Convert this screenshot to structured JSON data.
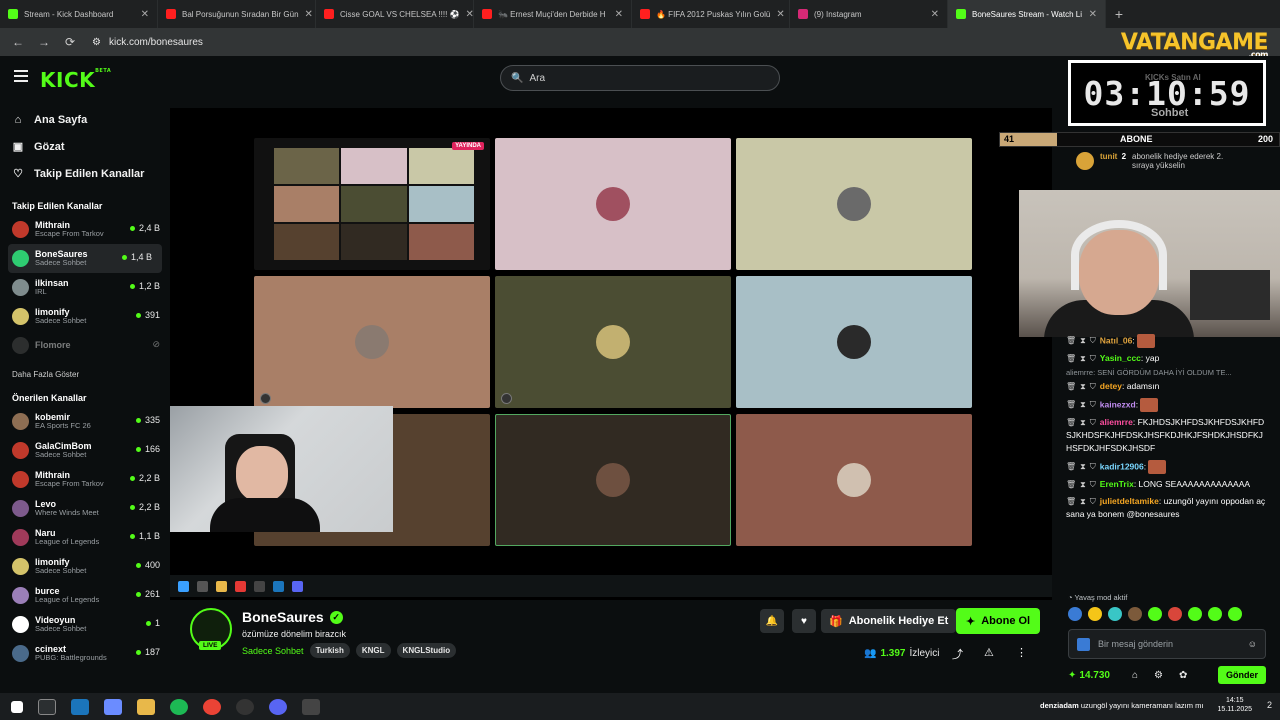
{
  "browser": {
    "tabs": [
      {
        "title": "Stream - Kick Dashboard",
        "color": "#53fc18"
      },
      {
        "title": "Bal Porsuğunun Sıradan Bir Gün",
        "color": "#ff1f1f"
      },
      {
        "title": "Cisse GOAL VS CHELSEA !!!! ⚽",
        "color": "#ff1f1f"
      },
      {
        "title": "🐜 Ernest Muçi'den Derbide H",
        "color": "#ff1f1f"
      },
      {
        "title": "🔥 FIFA 2012 Puskas Yılın Golü",
        "color": "#ff1f1f"
      },
      {
        "title": "(9) Instagram",
        "color": "#d62976"
      },
      {
        "title": "BoneSaures Stream - Watch Li",
        "color": "#53fc18",
        "active": true
      }
    ],
    "new_tab": "+",
    "url": "kick.com/bonesaures"
  },
  "overlay_logo": {
    "brand": "VATANGAME",
    "sub": ".com"
  },
  "header": {
    "logo": "KICK",
    "logo_sup": "BETA",
    "search_placeholder": "Ara"
  },
  "sidebar": {
    "nav": [
      {
        "label": "Ana Sayfa",
        "icon": "home-icon"
      },
      {
        "label": "Gözat",
        "icon": "browse-icon"
      },
      {
        "label": "Takip Edilen Kanallar",
        "icon": "heart-icon"
      }
    ],
    "followed_title": "Takip Edilen Kanallar",
    "followed": [
      {
        "name": "Mithrain",
        "category": "Escape From Tarkov",
        "viewers": "2,4 B",
        "color": "#c0392b"
      },
      {
        "name": "BoneSaures",
        "category": "Sadece Sohbet",
        "viewers": "1,4 B",
        "color": "#2ecc71",
        "selected": true
      },
      {
        "name": "ilkinsan",
        "category": "IRL",
        "viewers": "1,2 B",
        "color": "#7f8c8d"
      },
      {
        "name": "limonify",
        "category": "Sadece Sohbet",
        "viewers": "391",
        "color": "#d4c36a"
      },
      {
        "name": "Flomore",
        "category": "",
        "viewers": "",
        "color": "#555",
        "offline": true
      }
    ],
    "show_more": "Daha Fazla Göster",
    "recommended_title": "Önerilen Kanallar",
    "recommended": [
      {
        "name": "kobemir",
        "category": "EA Sports FC 26",
        "viewers": "335",
        "color": "#8e6e53"
      },
      {
        "name": "GalaCimBom",
        "category": "Sadece Sohbet",
        "viewers": "166",
        "color": "#c0392b"
      },
      {
        "name": "Mithrain",
        "category": "Escape From Tarkov",
        "viewers": "2,2 B",
        "color": "#c0392b"
      },
      {
        "name": "Levo",
        "category": "Where Winds Meet",
        "viewers": "2,2 B",
        "color": "#7d5a8c"
      },
      {
        "name": "Naru",
        "category": "League of Legends",
        "viewers": "1,1 B",
        "color": "#a03a5a"
      },
      {
        "name": "limonify",
        "category": "Sadece Sohbet",
        "viewers": "400",
        "color": "#d4c36a"
      },
      {
        "name": "burce",
        "category": "League of Legends",
        "viewers": "261",
        "color": "#9b7fb8"
      },
      {
        "name": "Videoyun",
        "category": "Sadece Sohbet",
        "viewers": "1",
        "color": "#ffffff"
      },
      {
        "name": "ccinext",
        "category": "PUBG: Battlegrounds",
        "viewers": "187",
        "color": "#4a6a8a"
      }
    ]
  },
  "player": {
    "live_label": "YAYINDA",
    "tile_colors": [
      "#d7c0c7",
      "#c9c8a7",
      "#a97f67",
      "#4b4d33",
      "#a8bfc6",
      "#56412f",
      "#312a22",
      "#8e5a4b"
    ]
  },
  "channel": {
    "name": "BoneSaures",
    "live": "LIVE",
    "stream_title": "özümüze dönelim birazcık",
    "category": "Sadece Sohbet",
    "tags": [
      "Turkish",
      "KNGL",
      "KNGLStudio"
    ],
    "gift_label": "Abonelik Hediye Et",
    "subscribe_label": "Abone Ol",
    "viewers": "1.397",
    "viewers_label": "İzleyici"
  },
  "chat": {
    "timer": "03:10:59",
    "kicks_label": "KICKs Satın Al",
    "sohbet_label": "Sohbet",
    "progress": {
      "left": "41",
      "mid": "ABONE",
      "right": "200",
      "fraction": 0.205
    },
    "pinned_user": "tunit",
    "pinned_text": "abonelik hediye ederek 2. sıraya yükselin",
    "pinned_count": "2",
    "messages": [
      {
        "user": "Natıl_06",
        "color": "#e0a33e",
        "text": "",
        "emote": true
      },
      {
        "user": "Yasin_ccc",
        "color": "#53fc18",
        "text": "yap"
      },
      {
        "reply": "aliemrre: SENİ GÖRDÜM DAHA İYİ OLDUM TE..."
      },
      {
        "user": "detey",
        "color": "#f5a623",
        "text": "adamsın"
      },
      {
        "user": "kainezxd",
        "color": "#c08cf0",
        "text": "",
        "emote": true
      },
      {
        "user": "aliemrre",
        "color": "#ff4fa0",
        "text": "FKJHDSJKHFDSJKHFDSJKHFDSJKHDSFKJHFDSKJHSFKDJHKJFSHDKJHSDFKJHSFDKJHFSDKJHSDF"
      },
      {
        "user": "kadir12906",
        "color": "#7ad7ff",
        "text": "",
        "emote": true
      },
      {
        "user": "ErenTrix",
        "color": "#53fc18",
        "text": "LONG SEAAAAAAAAAAAAA"
      },
      {
        "user": "julietdeltamike",
        "color": "#f5a623",
        "text": "uzungöl yayını oppodan açsana ya bonem @bonesaures"
      }
    ],
    "slow_mode": "Yavaş mod aktif",
    "input_placeholder": "Bir mesaj gönderin",
    "points": "14.730",
    "send_label": "Gönder"
  },
  "taskbar": {
    "ticker_user": "denziadam",
    "ticker_text": "uzungöl yayını kameramanı lazım mı",
    "time": "14:15",
    "date": "15.11.2025",
    "notif": "2"
  }
}
